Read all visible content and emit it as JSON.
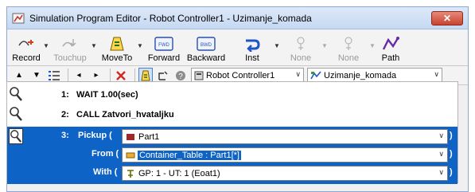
{
  "window": {
    "title": "Simulation Program Editor - Robot Controller1 - Uzimanje_komada",
    "close_glyph": "✕"
  },
  "ribbon": {
    "buttons": [
      {
        "label": "Record",
        "icon": "record-icon"
      },
      {
        "label": "Touchup",
        "icon": "touchup-icon"
      },
      {
        "label": "MoveTo",
        "icon": "moveto-icon"
      },
      {
        "label": "Forward",
        "icon": "forward-icon"
      },
      {
        "label": "Backward",
        "icon": "backward-icon"
      },
      {
        "label": "Inst",
        "icon": "inst-icon"
      },
      {
        "label": "None",
        "icon": "none-icon"
      },
      {
        "label": "None",
        "icon": "none-icon"
      },
      {
        "label": "Path",
        "icon": "path-icon"
      }
    ],
    "icon_fwd_text": "FWD",
    "icon_bwd_text": "BWD"
  },
  "toolbar2": {
    "controller": "Robot Controller1",
    "program": "Uzimanje_komada"
  },
  "editor": {
    "lines": [
      {
        "num": "1:",
        "text": "WAIT 1.00(sec)"
      },
      {
        "num": "2:",
        "text": "CALL Zatvori_hvataljku"
      }
    ],
    "selected": {
      "num": "3:",
      "pickup_label": "Pickup (",
      "pickup_value": "Part1",
      "from_label": "From (",
      "from_value": "Container_Table : Part1[*]",
      "with_label": "With (",
      "with_value": "GP: 1 - UT: 1  (Eoat1)",
      "close_paren": ")"
    }
  },
  "colors": {
    "selection": "#0e63c7",
    "title_bg": "#c5d8f2"
  }
}
